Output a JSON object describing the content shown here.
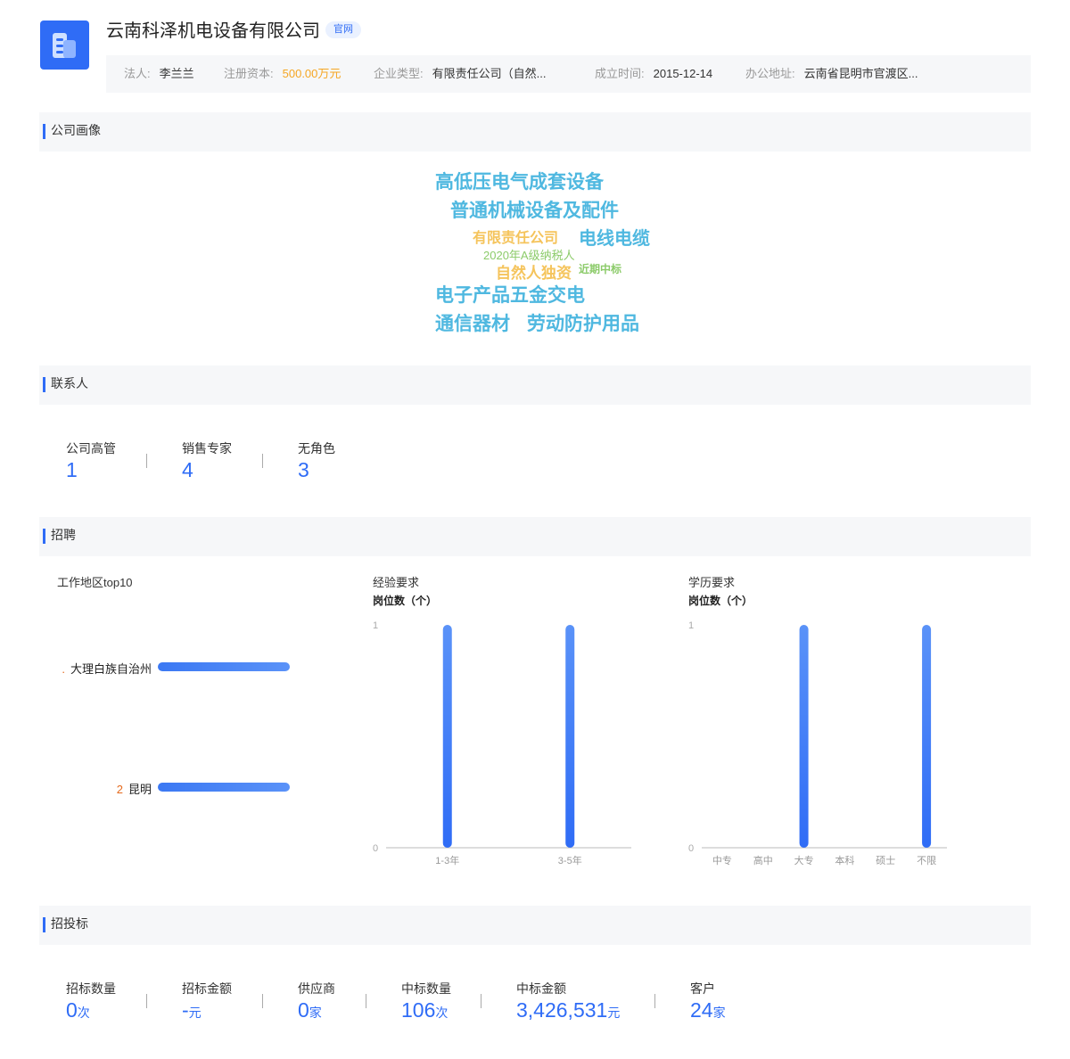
{
  "company": {
    "name": "云南科泽机电设备有限公司",
    "badge": "官网",
    "info": [
      {
        "key": "法人:",
        "value": "李兰兰"
      },
      {
        "key": "注册资本:",
        "value": "500.00万元"
      },
      {
        "key": "企业类型:",
        "value": "有限责任公司（自然..."
      },
      {
        "key": "成立时间:",
        "value": "2015-12-14"
      },
      {
        "key": "办公地址:",
        "value": "云南省昆明市官渡区..."
      }
    ],
    "colors": {
      "accent": "#2f6cf6",
      "capital": "#f5a623"
    }
  },
  "portrait": {
    "title": "公司画像",
    "tags": [
      {
        "text": "高低压电气成套设备",
        "color": "#4fb8e0"
      },
      {
        "text": "普通机械设备及配件",
        "color": "#4fb8e0"
      },
      {
        "text": "有限责任公司",
        "color": "#f5c45c"
      },
      {
        "text": "电线电缆",
        "color": "#4fb8e0"
      },
      {
        "text": "2020年A级纳税人",
        "color": "#8ccb6a"
      },
      {
        "text": "自然人独资",
        "color": "#f5c45c"
      },
      {
        "text": "近期中标",
        "color": "#8ccb6a"
      },
      {
        "text": "电子产品五金交电",
        "color": "#4fb8e0"
      },
      {
        "text": "通信器材",
        "color": "#4fb8e0"
      },
      {
        "text": "劳动防护用品",
        "color": "#4fb8e0"
      }
    ]
  },
  "contacts": {
    "title": "联系人",
    "items": [
      {
        "label": "公司高管",
        "value": "1"
      },
      {
        "label": "销售专家",
        "value": "4"
      },
      {
        "label": "无角色",
        "value": "3"
      }
    ]
  },
  "recruit": {
    "title": "招聘",
    "region": {
      "title": "工作地区top10",
      "rows": [
        {
          "rank": ".",
          "name": "大理白族自治州"
        },
        {
          "rank": "2",
          "name": "昆明"
        }
      ]
    }
  },
  "chart_data": [
    {
      "type": "bar",
      "title": "工作地区top10",
      "orientation": "horizontal",
      "categories": [
        "大理白族自治州",
        "昆明"
      ],
      "values": [
        1,
        1
      ]
    },
    {
      "type": "bar",
      "title": "经验要求",
      "ylabel": "岗位数（个）",
      "categories": [
        "1-3年",
        "3-5年"
      ],
      "values": [
        1,
        1
      ],
      "ylim": [
        0,
        1
      ],
      "yticks": [
        "0",
        "1"
      ]
    },
    {
      "type": "bar",
      "title": "学历要求",
      "ylabel": "岗位数（个）",
      "categories": [
        "中专",
        "高中",
        "大专",
        "本科",
        "硕士",
        "不限"
      ],
      "values": [
        0,
        0,
        1,
        0,
        0,
        1
      ],
      "ylim": [
        0,
        1
      ],
      "yticks": [
        "0",
        "1"
      ]
    }
  ],
  "bidding": {
    "title": "招投标",
    "items": [
      {
        "label": "招标数量",
        "value": "0",
        "unit": "次"
      },
      {
        "label": "招标金额",
        "value": "-",
        "unit": "元"
      },
      {
        "label": "供应商",
        "value": "0",
        "unit": "家"
      },
      {
        "label": "中标数量",
        "value": "106",
        "unit": "次"
      },
      {
        "label": "中标金额",
        "value": "3,426,531",
        "unit": "元"
      },
      {
        "label": "客户",
        "value": "24",
        "unit": "家"
      }
    ]
  }
}
